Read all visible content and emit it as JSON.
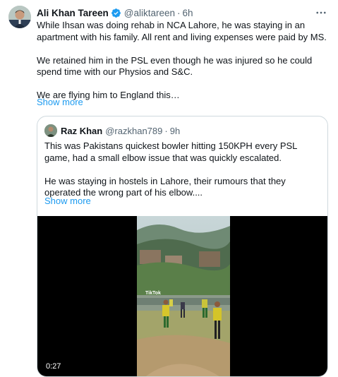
{
  "tweet": {
    "author_name": "Ali Khan Tareen",
    "author_handle": "@aliktareen",
    "separator": "·",
    "time": "6h",
    "verified_icon": "verified-badge-icon",
    "paragraphs": [
      "While Ihsan was doing rehab in NCA Lahore, he was staying in an apartment with his family. All rent and living expenses were paid by MS.",
      "We retained him in the PSL even though he was injured so he could spend time with our Physios and S&C.",
      "We are flying him to England this…"
    ],
    "show_more": "Show more"
  },
  "quote": {
    "author_name": "Raz Khan",
    "author_handle": "@razkhan789",
    "separator": "·",
    "time": "9h",
    "paragraphs": [
      "This was Pakistans quickest bowler hitting 150KPH every PSL game, had a small elbow issue that was quickly escalated.",
      "He was staying in hostels in Lahore, their rumours that they operated the wrong part of his elbow...."
    ],
    "show_more": "Show more",
    "video": {
      "duration": "0:27",
      "watermark": "TikTok"
    }
  },
  "colors": {
    "link": "#1d9bf0",
    "verified": "#1d9bf0",
    "muted": "#536471",
    "border": "#cfd9de"
  }
}
